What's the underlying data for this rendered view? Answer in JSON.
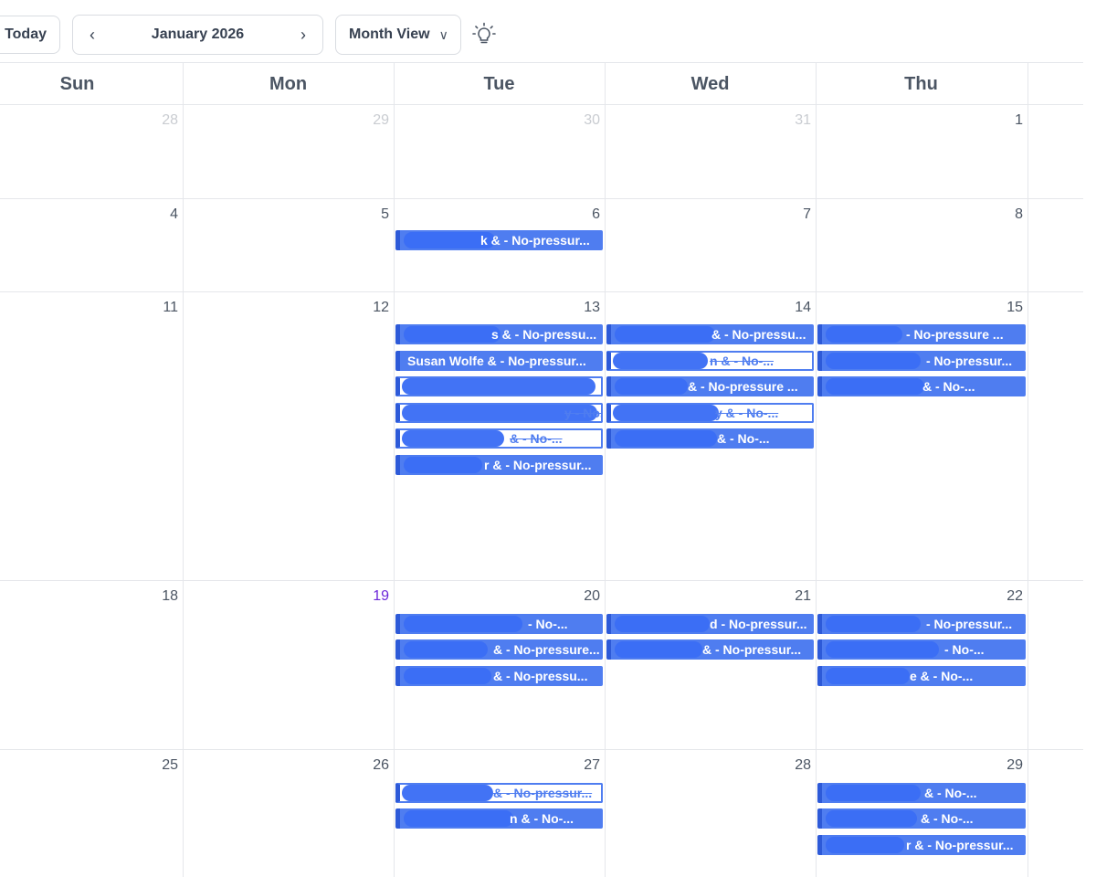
{
  "toolbar": {
    "today_label": "Today",
    "prev_icon": "chevron-left-icon",
    "next_icon": "chevron-right-icon",
    "month_label": "January 2026",
    "view_label": "Month View",
    "view_chevron": "chevron-down-icon",
    "bulb_icon": "lightbulb-icon"
  },
  "weekdays": [
    "Sun",
    "Mon",
    "Tue",
    "Wed",
    "Thu"
  ],
  "weeks": [
    [
      "28",
      "29",
      "30",
      "31",
      "1"
    ],
    [
      "4",
      "5",
      "6",
      "7",
      "8"
    ],
    [
      "11",
      "12",
      "13",
      "14",
      "15"
    ],
    [
      "18",
      "19",
      "20",
      "21",
      "22"
    ],
    [
      "25",
      "26",
      "27",
      "28",
      "29"
    ]
  ],
  "events": {
    "tue_6": [
      "k &  - No-pressur..."
    ],
    "tue_13": [
      "s &  - No-pressu...",
      "Susan Wolfe &  - No-pressur...",
      "",
      "y - No...",
      "& - No-...",
      "r &  - No-pressur..."
    ],
    "wed_14": [
      "&  - No-pressu...",
      "n &  - No-...",
      "&  - No-pressure ...",
      "y &  - No-...",
      "&  - No-..."
    ],
    "thu_15": [
      "- No-pressure ...",
      "- No-pressur...",
      "&  - No-..."
    ],
    "tue_20": [
      "- No-...",
      "&  - No-pressure...",
      "&  - No-pressu..."
    ],
    "wed_21": [
      "d - No-pressur...",
      "&  - No-pressur..."
    ],
    "thu_22": [
      "- No-pressur...",
      "- No-...",
      "e &  - No-..."
    ],
    "tue_27": [
      "&  - No-pressur...",
      "n &  - No-..."
    ],
    "thu_29": [
      "&  - No-...",
      "&  - No-...",
      "r &  - No-pressur..."
    ]
  },
  "colors": {
    "event_fill": "#4f7df0",
    "event_edge": "#2d5ad8",
    "today_number": "#6d28d9",
    "muted_number": "#c9ccd1"
  }
}
